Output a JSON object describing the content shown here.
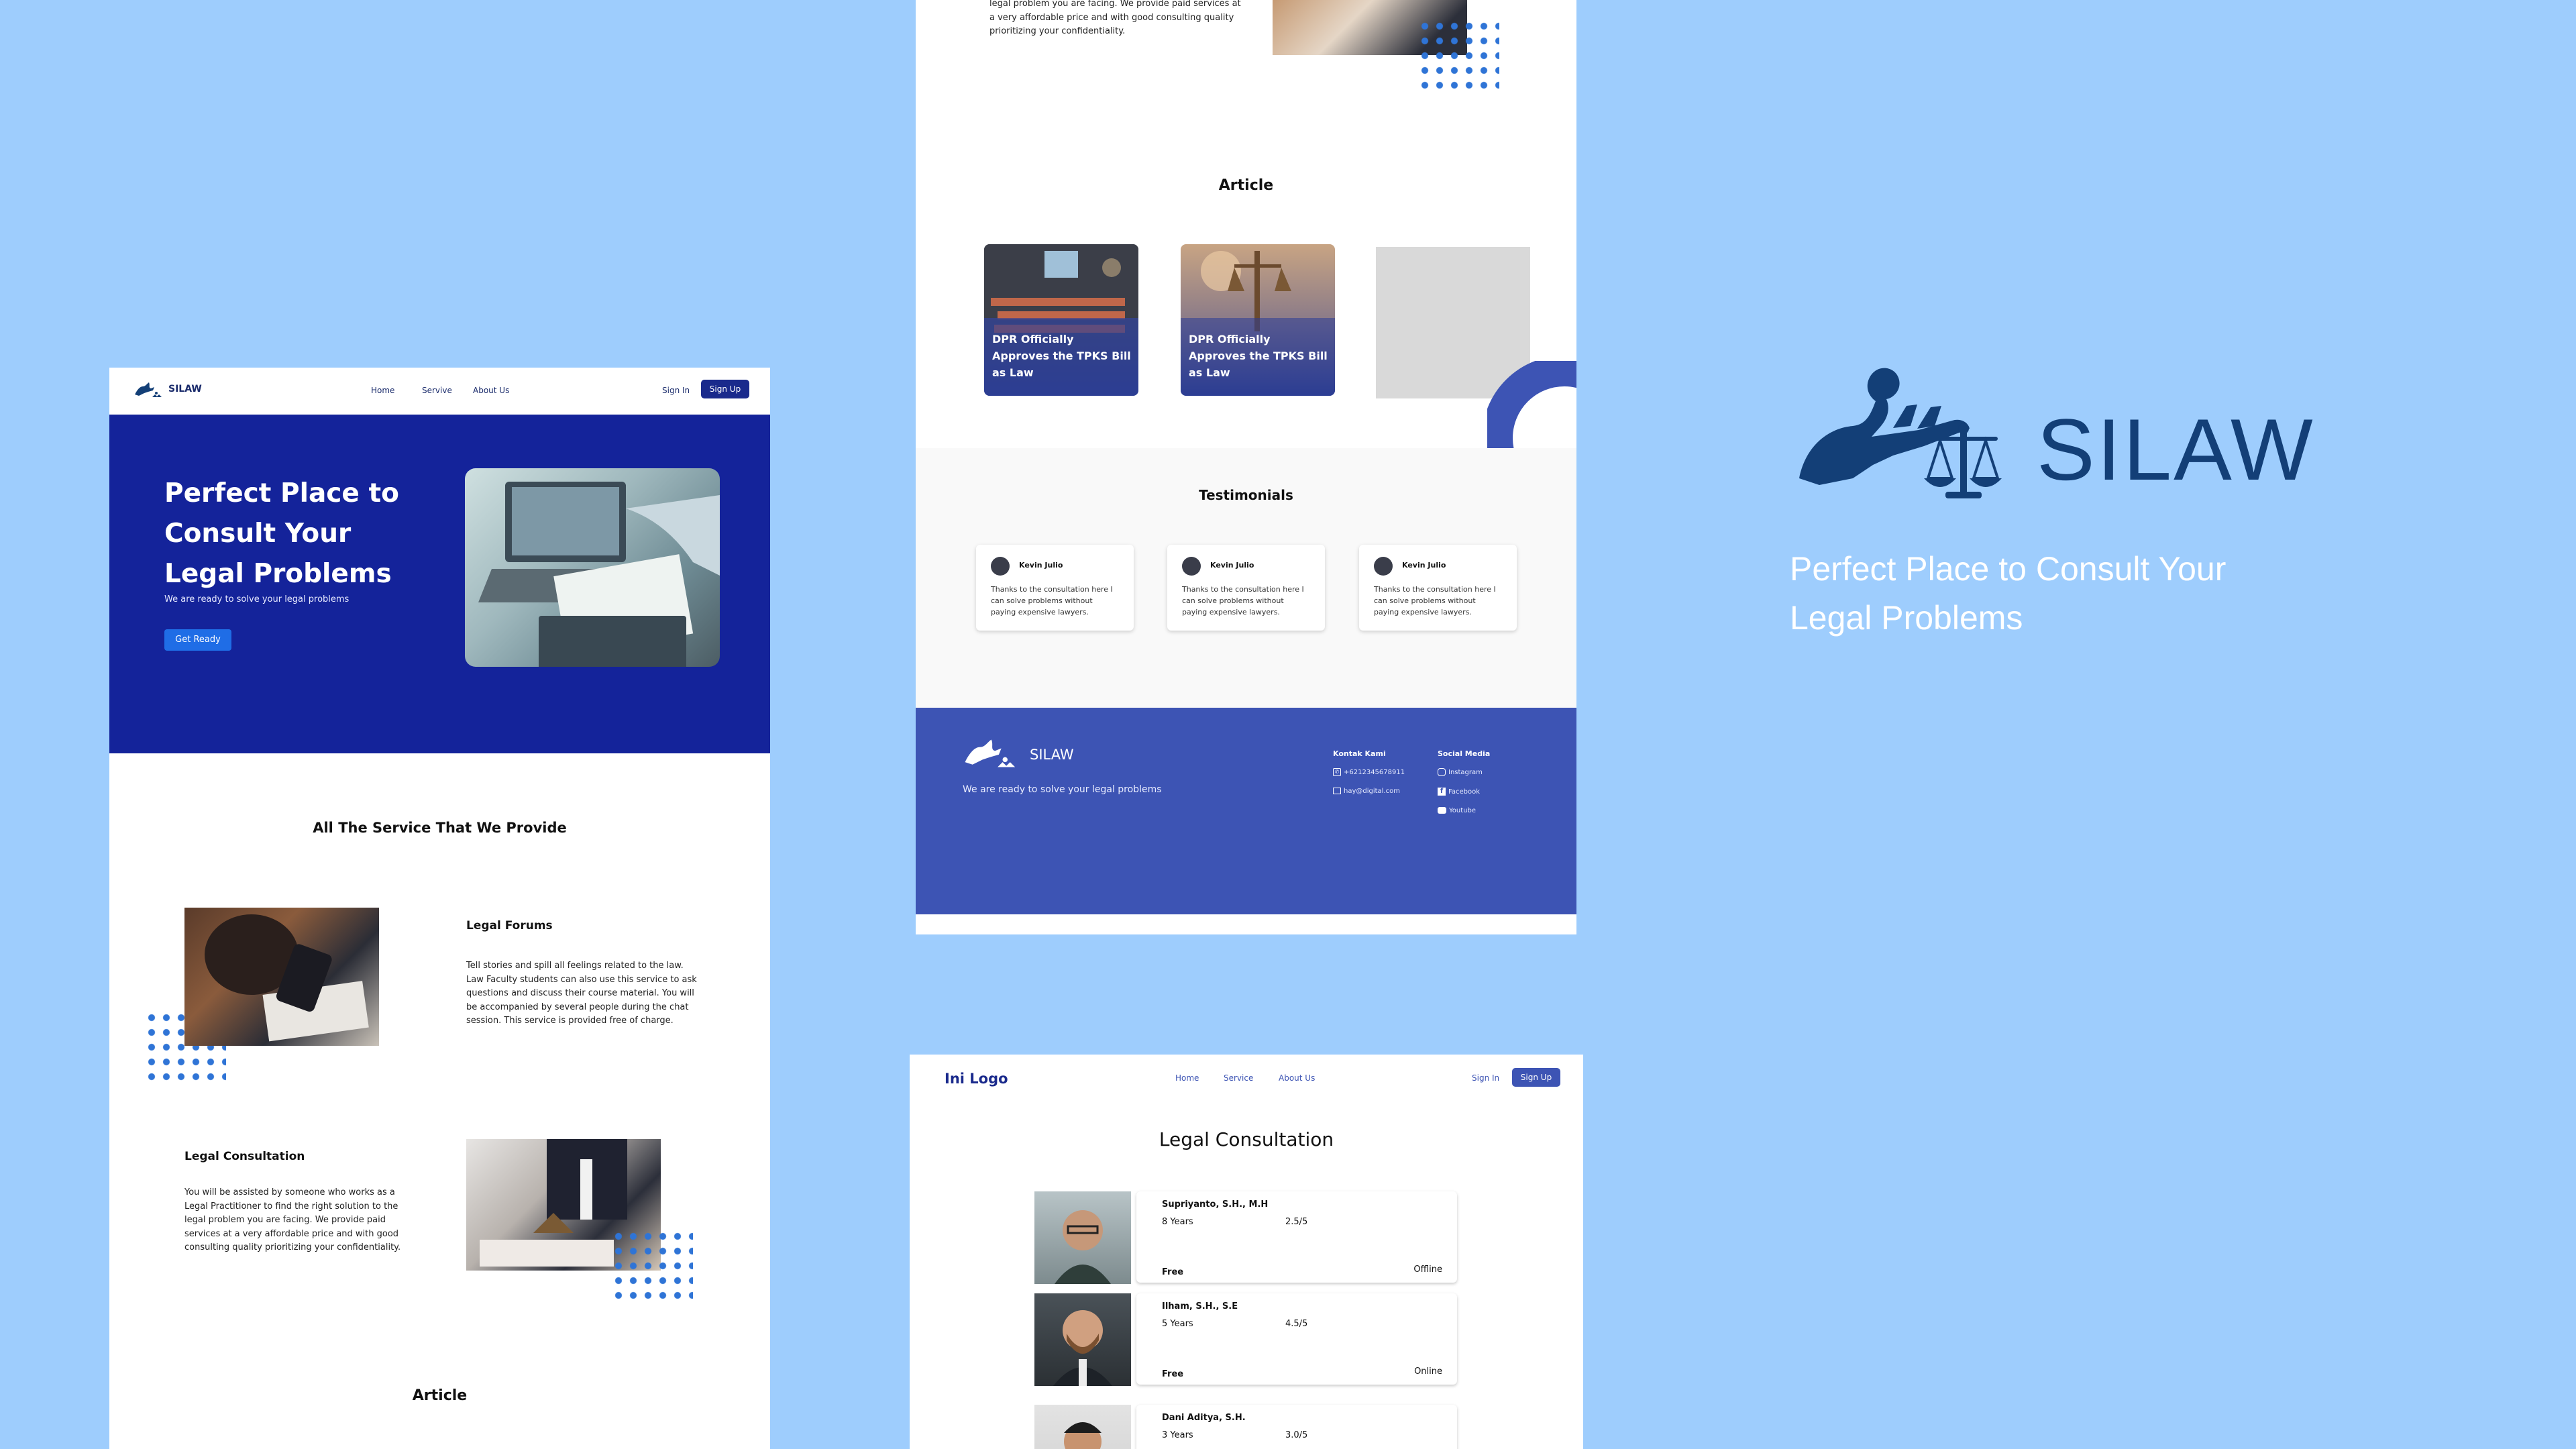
{
  "colors": {
    "background": "#9ecdfd",
    "hero_blue": "#14239a",
    "footer_blue": "#3d54b4",
    "brand_navy": "#133f77",
    "accent_blue": "#1f6de6"
  },
  "home": {
    "nav": {
      "logo_text": "SILAW",
      "links": [
        "Home",
        "Servive",
        "About Us"
      ],
      "sign_in": "Sign In",
      "sign_up": "Sign Up"
    },
    "hero": {
      "title": "Perfect Place to Consult Your Legal Problems",
      "subtitle": "We are ready to solve your legal problems",
      "button": "Get Ready"
    },
    "services_title": "All The Service That We Provide",
    "services": [
      {
        "title": "Legal Forums",
        "text": "Tell stories and spill all feelings related to the law. Law Faculty students can also use this service to ask questions and discuss their course material. You will be accompanied by several people during the chat session. This service is provided free of charge."
      },
      {
        "title": "Legal Consultation",
        "text": "You will be assisted by someone who works as a Legal Practitioner to find the right solution to the legal problem you are facing. We provide paid services at a very affordable price and with good consulting quality prioritizing your confidentiality."
      }
    ],
    "article_title": "Article"
  },
  "landing_lower": {
    "top_text": "legal problem you are facing. We provide paid services at a very affordable price and with good consulting quality prioritizing your confidentiality.",
    "article_title": "Article",
    "articles": [
      {
        "caption": "DPR Officially Approves the TPKS Bill as Law"
      },
      {
        "caption": "DPR Officially Approves the TPKS Bill as Law"
      }
    ],
    "testimonials_title": "Testimonials",
    "testimonials": [
      {
        "name": "Kevin Julio",
        "text": "Thanks to the consultation here I can solve problems without paying expensive lawyers."
      },
      {
        "name": "Kevin Julio",
        "text": "Thanks to the consultation here I can solve problems without paying expensive lawyers."
      },
      {
        "name": "Kevin Julio",
        "text": "Thanks to the consultation here I can solve problems without paying expensive lawyers."
      }
    ],
    "footer": {
      "logo_text": "SILAW",
      "tagline": "We are ready to solve your legal problems",
      "contact_title": "Kontak Kami",
      "phone": "+6212345678911",
      "email": "hay@digital.com",
      "social_title": "Social Media",
      "social": [
        "Instagram",
        "Facebook",
        "Youtube"
      ]
    }
  },
  "consultation": {
    "nav": {
      "logo_text": "Ini Logo",
      "links": [
        "Home",
        "Service",
        "About Us"
      ],
      "sign_in": "Sign In",
      "sign_up": "Sign Up"
    },
    "title": "Legal Consultation",
    "lawyers": [
      {
        "name": "Supriyanto, S.H., M.H",
        "years": "8 Years",
        "rating": "2.5/5",
        "price": "Free",
        "status": "Offline"
      },
      {
        "name": "Ilham, S.H., S.E",
        "years": "5 Years",
        "rating": "4.5/5",
        "price": "Free",
        "status": "Online"
      },
      {
        "name": "Dani Aditya, S.H.",
        "years": "3 Years",
        "rating": "3.0/5",
        "price": "",
        "status": ""
      }
    ]
  },
  "brand": {
    "name": "SILAW",
    "tagline": "Perfect Place to Consult Your Legal Problems"
  }
}
